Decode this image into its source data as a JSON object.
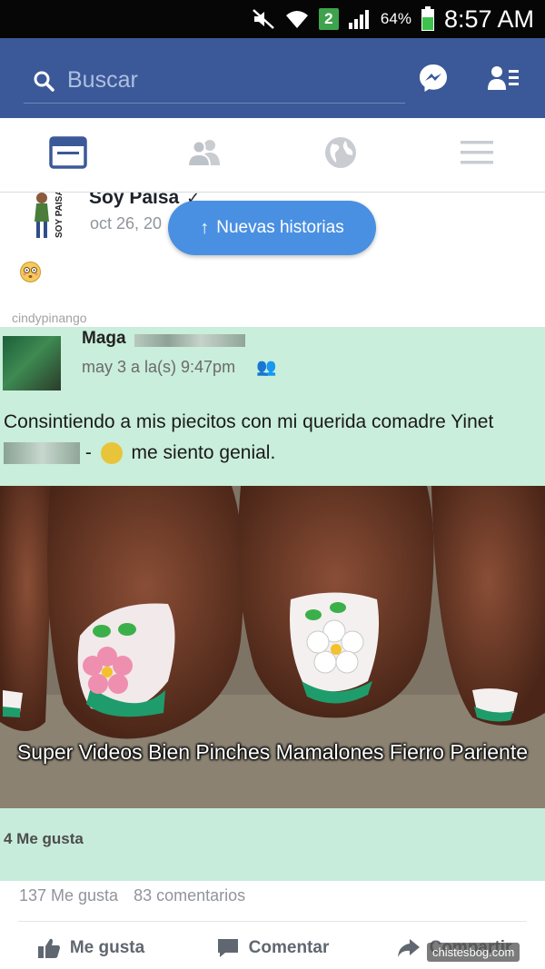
{
  "status_bar": {
    "battery_percent": "64%",
    "sim_number": "2",
    "time": "8:57 AM",
    "icons": [
      "mute-icon",
      "wifi-icon",
      "sim-icon",
      "signal-icon",
      "battery-icon"
    ]
  },
  "app_bar": {
    "search_placeholder": "Buscar",
    "icons": [
      "search-icon",
      "messenger-icon",
      "friend-requests-icon"
    ],
    "brand_color": "#3b5998"
  },
  "tabs": [
    {
      "name": "news-feed",
      "icon": "news-feed-icon",
      "active": true
    },
    {
      "name": "friends",
      "icon": "friends-icon",
      "active": false
    },
    {
      "name": "notifications",
      "icon": "globe-icon",
      "active": false
    },
    {
      "name": "menu",
      "icon": "menu-icon",
      "active": false
    }
  ],
  "post": {
    "page_name": "Soy Paisa",
    "avatar_text": "SOY PAISA",
    "date": "oct 26, 20",
    "new_stories_label": "Nuevas historias",
    "watermark": "cindypinango",
    "shared_image": {
      "author_name": "Maga",
      "date": "may 3 a la(s) 9:47pm",
      "caption_line1": "Consintiendo a mis piecitos con mi querida comadre Yinet",
      "caption_line2": "me siento genial.",
      "caption_separator": "-",
      "overlay_text": "Super Videos Bien Pinches Mamalones Fierro Pariente",
      "likes": "4 Me gusta"
    },
    "stats": {
      "likes": "137 Me gusta",
      "comments": "83 comentarios"
    },
    "actions": {
      "like": "Me gusta",
      "comment": "Comentar",
      "share": "Compartir"
    },
    "bottom_watermark": "chistesbog.com"
  },
  "colors": {
    "new_stories_bg": "#4a90e2",
    "screenshot_bg": "#c9eedb",
    "action_text": "#606770"
  }
}
